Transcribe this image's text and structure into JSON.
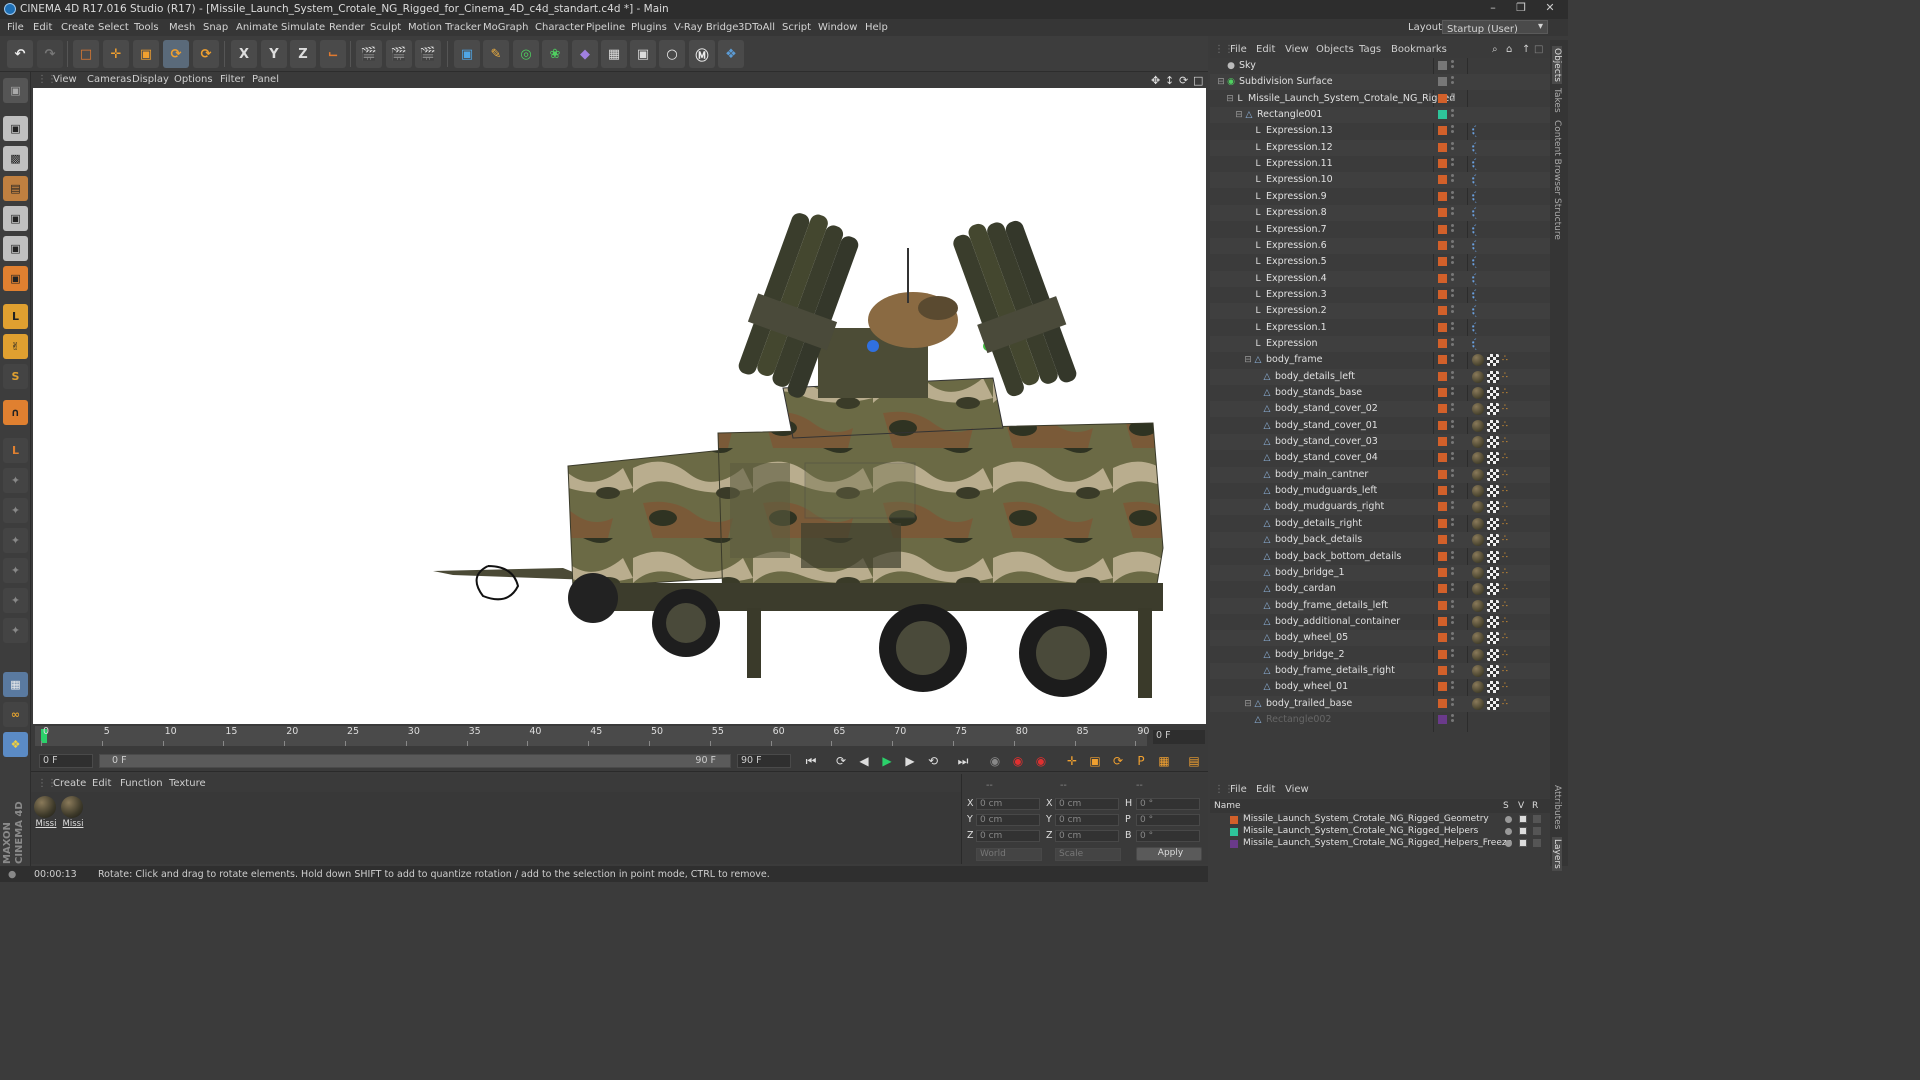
{
  "window": {
    "title": "CINEMA 4D R17.016 Studio (R17) - [Missile_Launch_System_Crotale_NG_Rigged_for_Cinema_4D_c4d_standart.c4d *] - Main"
  },
  "menubar": {
    "items": [
      "File",
      "Edit",
      "Create",
      "Select",
      "Tools",
      "Mesh",
      "Snap",
      "Animate",
      "Simulate",
      "Render",
      "Sculpt",
      "Motion Tracker",
      "MoGraph",
      "Character",
      "Pipeline",
      "Plugins",
      "V-Ray Bridge",
      "3DToAll",
      "Script",
      "Window",
      "Help"
    ],
    "layout_label": "Layout:",
    "layout_value": "Startup (User)"
  },
  "viewport": {
    "menu": [
      "View",
      "Cameras",
      "Display",
      "Options",
      "Filter",
      "Panel"
    ]
  },
  "timeline": {
    "ticks": [
      "0",
      "5",
      "10",
      "15",
      "20",
      "25",
      "30",
      "35",
      "40",
      "45",
      "50",
      "55",
      "60",
      "65",
      "70",
      "75",
      "80",
      "85",
      "90"
    ],
    "current_frame": "0 F",
    "start_field": "0 F",
    "range_start": "0 F",
    "range_end": "90 F",
    "end_field": "90 F"
  },
  "materials": {
    "menu": [
      "Create",
      "Edit",
      "Function",
      "Texture"
    ],
    "items": [
      {
        "name": "Missi"
      },
      {
        "name": "Missi"
      }
    ]
  },
  "coordinates": {
    "labels": [
      "X",
      "Y",
      "Z"
    ],
    "size_labels": [
      "X",
      "Y",
      "Z"
    ],
    "rot_labels": [
      "H",
      "P",
      "B"
    ],
    "pos_value": "0 cm",
    "size_value": "0 cm",
    "rot_value": "0 °",
    "header_a": "--",
    "header_b": "--",
    "header_c": "--",
    "mode_world": "World",
    "mode_scale": "Scale",
    "apply_label": "Apply"
  },
  "status": {
    "time": "00:00:13",
    "message": "Rotate: Click and drag to rotate elements. Hold down SHIFT to add to quantize rotation / add to the selection in point mode, CTRL to remove."
  },
  "object_manager": {
    "menu": [
      "File",
      "Edit",
      "View",
      "Objects",
      "Tags",
      "Bookmarks"
    ],
    "objects": [
      {
        "name": "Sky",
        "depth": 0,
        "icon": "sky"
      },
      {
        "name": "Subdivision Surface",
        "depth": 0,
        "icon": "subdiv"
      },
      {
        "name": "Missile_Launch_System_Crotale_NG_Rigged",
        "depth": 1,
        "icon": "null"
      },
      {
        "name": "Rectangle001",
        "depth": 2,
        "icon": "poly"
      },
      {
        "name": "Expression.13",
        "depth": 3,
        "icon": "null"
      },
      {
        "name": "Expression.12",
        "depth": 3,
        "icon": "null"
      },
      {
        "name": "Expression.11",
        "depth": 3,
        "icon": "null"
      },
      {
        "name": "Expression.10",
        "depth": 3,
        "icon": "null"
      },
      {
        "name": "Expression.9",
        "depth": 3,
        "icon": "null"
      },
      {
        "name": "Expression.8",
        "depth": 3,
        "icon": "null"
      },
      {
        "name": "Expression.7",
        "depth": 3,
        "icon": "null"
      },
      {
        "name": "Expression.6",
        "depth": 3,
        "icon": "null"
      },
      {
        "name": "Expression.5",
        "depth": 3,
        "icon": "null"
      },
      {
        "name": "Expression.4",
        "depth": 3,
        "icon": "null"
      },
      {
        "name": "Expression.3",
        "depth": 3,
        "icon": "null"
      },
      {
        "name": "Expression.2",
        "depth": 3,
        "icon": "null"
      },
      {
        "name": "Expression.1",
        "depth": 3,
        "icon": "null"
      },
      {
        "name": "Expression",
        "depth": 3,
        "icon": "null"
      },
      {
        "name": "body_frame",
        "depth": 3,
        "icon": "poly"
      },
      {
        "name": "body_details_left",
        "depth": 4,
        "icon": "poly"
      },
      {
        "name": "body_stands_base",
        "depth": 4,
        "icon": "poly"
      },
      {
        "name": "body_stand_cover_02",
        "depth": 4,
        "icon": "poly"
      },
      {
        "name": "body_stand_cover_01",
        "depth": 4,
        "icon": "poly"
      },
      {
        "name": "body_stand_cover_03",
        "depth": 4,
        "icon": "poly"
      },
      {
        "name": "body_stand_cover_04",
        "depth": 4,
        "icon": "poly"
      },
      {
        "name": "body_main_cantner",
        "depth": 4,
        "icon": "poly"
      },
      {
        "name": "body_mudguards_left",
        "depth": 4,
        "icon": "poly"
      },
      {
        "name": "body_mudguards_right",
        "depth": 4,
        "icon": "poly"
      },
      {
        "name": "body_details_right",
        "depth": 4,
        "icon": "poly"
      },
      {
        "name": "body_back_details",
        "depth": 4,
        "icon": "poly"
      },
      {
        "name": "body_back_bottom_details",
        "depth": 4,
        "icon": "poly"
      },
      {
        "name": "body_bridge_1",
        "depth": 4,
        "icon": "poly"
      },
      {
        "name": "body_cardan",
        "depth": 4,
        "icon": "poly"
      },
      {
        "name": "body_frame_details_left",
        "depth": 4,
        "icon": "poly"
      },
      {
        "name": "body_additional_container",
        "depth": 4,
        "icon": "poly"
      },
      {
        "name": "body_wheel_05",
        "depth": 4,
        "icon": "poly"
      },
      {
        "name": "body_bridge_2",
        "depth": 4,
        "icon": "poly"
      },
      {
        "name": "body_frame_details_right",
        "depth": 4,
        "icon": "poly"
      },
      {
        "name": "body_wheel_01",
        "depth": 4,
        "icon": "poly"
      },
      {
        "name": "body_trailed_base",
        "depth": 3,
        "icon": "poly"
      },
      {
        "name": "Rectangle002",
        "depth": 3,
        "icon": "poly"
      }
    ]
  },
  "layer_manager": {
    "menu": [
      "File",
      "Edit",
      "View"
    ],
    "header_name": "Name",
    "header_s": "S",
    "header_v": "V",
    "header_r": "R",
    "layers": [
      {
        "name": "Missile_Launch_System_Crotale_NG_Rigged_Geometry",
        "color": "#d2602a"
      },
      {
        "name": "Missile_Launch_System_Crotale_NG_Rigged_Helpers",
        "color": "#2ec49a"
      },
      {
        "name": "Missile_Launch_System_Crotale_NG_Rigged_Helpers_Freeze",
        "color": "#6a3a8a"
      }
    ]
  },
  "side_tabs": [
    "Objects",
    "Takes",
    "Content Browser",
    "Structure",
    "Attributes",
    "Layers"
  ],
  "colors": {
    "accent_orange": "#d2602a",
    "selection_blue": "#4c7fbf"
  }
}
